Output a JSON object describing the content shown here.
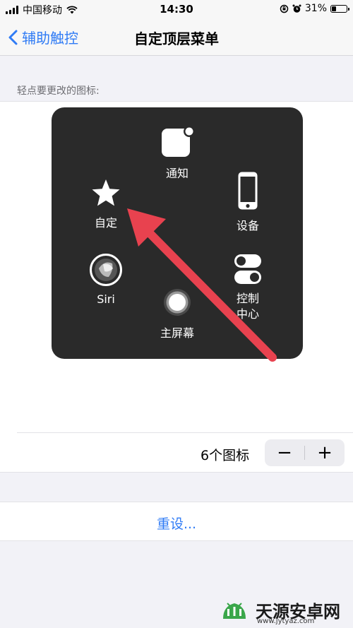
{
  "status_bar": {
    "carrier": "中国移动",
    "time": "14:30",
    "battery_percent": "31%",
    "battery_level": 0.31,
    "icons": [
      "signal-icon",
      "wifi-icon",
      "orientation-lock-icon",
      "alarm-icon",
      "battery-icon"
    ]
  },
  "nav": {
    "back_label": "辅助触控",
    "title": "自定顶层菜单"
  },
  "section_label": "轻点要更改的图标:",
  "menu": {
    "items": [
      {
        "id": "notifications",
        "label": "通知",
        "icon": "notification-icon"
      },
      {
        "id": "custom",
        "label": "自定",
        "icon": "star-icon"
      },
      {
        "id": "device",
        "label": "设备",
        "icon": "device-icon"
      },
      {
        "id": "siri",
        "label": "Siri",
        "icon": "siri-icon"
      },
      {
        "id": "control_center",
        "label": "控制\n中心",
        "icon": "toggle-icon"
      },
      {
        "id": "home",
        "label": "主屏幕",
        "icon": "home-button-icon"
      }
    ]
  },
  "icon_count": {
    "label": "6个图标",
    "minus": "−",
    "plus": "+"
  },
  "reset_label": "重设...",
  "watermark": {
    "text": "天源安卓网",
    "url": "www.jytyaz.com"
  },
  "colors": {
    "accent": "#2f7bf5",
    "menu_bg": "#2a2a2a",
    "arrow": "#e8424f"
  }
}
